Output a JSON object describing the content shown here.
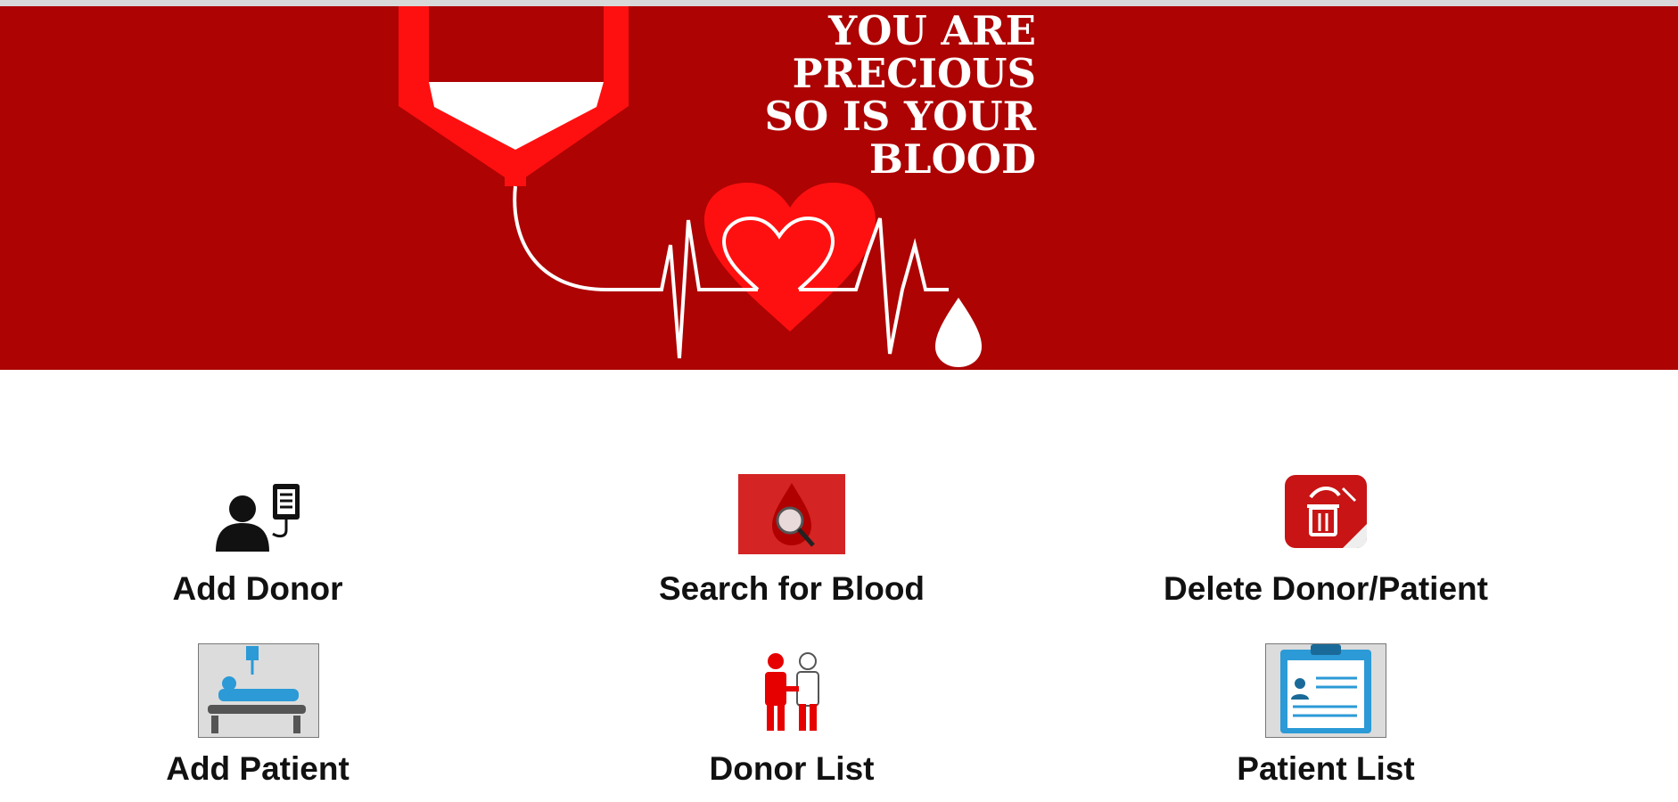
{
  "banner": {
    "slogan_lines": [
      "YOU ARE",
      "PRECIOUS",
      "SO IS YOUR",
      "BLOOD"
    ],
    "background_color": "#ad0303",
    "accent_color": "#ff0000"
  },
  "menu": {
    "add_donor": {
      "label": "Add Donor",
      "icon": "donor-icon"
    },
    "search_blood": {
      "label": "Search for Blood",
      "icon": "blood-search-icon"
    },
    "delete_donor_patient": {
      "label": "Delete Donor/Patient",
      "icon": "trash-icon"
    },
    "add_patient": {
      "label": "Add Patient",
      "icon": "patient-bed-icon"
    },
    "donor_list": {
      "label": "Donor List",
      "icon": "donors-pair-icon"
    },
    "patient_list": {
      "label": "Patient List",
      "icon": "clipboard-list-icon"
    }
  }
}
